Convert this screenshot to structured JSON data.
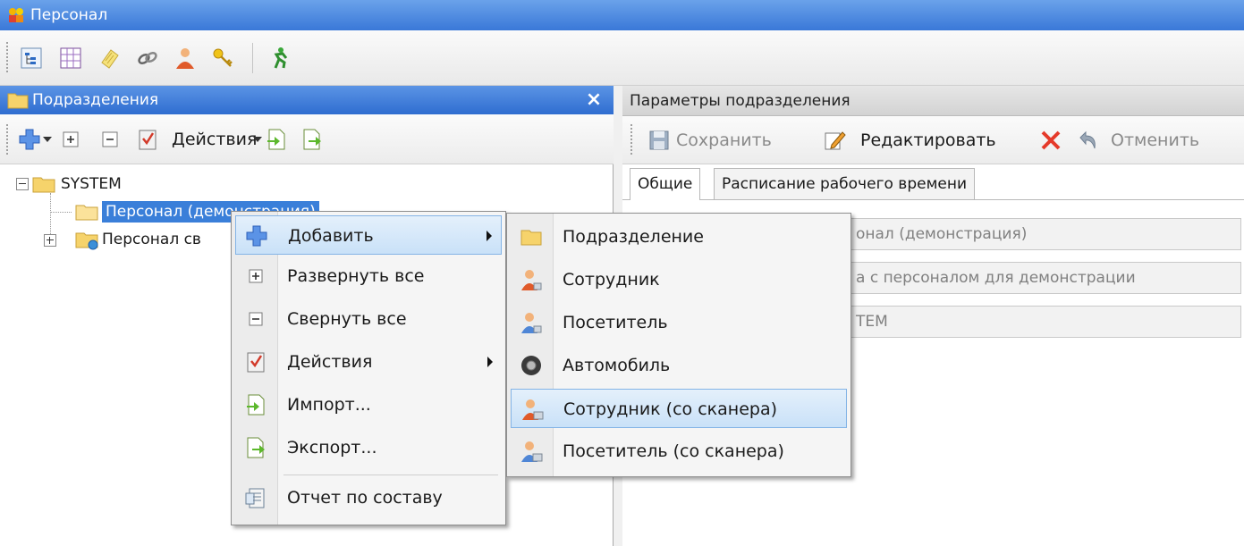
{
  "window": {
    "title": "Персонал"
  },
  "left_panel": {
    "title": "Подразделения",
    "close_symbol": "×",
    "toolbar": {
      "actions_label": "Действия"
    },
    "tree": {
      "root": "SYSTEM",
      "selected_child": "Персонал (демонстрация)",
      "second_child": "Персонал св"
    }
  },
  "right_panel": {
    "title": "Параметры подразделения",
    "toolbar": {
      "save": "Сохранить",
      "edit": "Редактировать",
      "cancel": "Отменить"
    },
    "tabs": [
      "Общие",
      "Расписание рабочего времени"
    ],
    "fields": [
      "онал (демонстрация)",
      "а с персоналом для демонстрации",
      "ТЕМ"
    ]
  },
  "context_menu": {
    "items": [
      {
        "label": "Добавить",
        "icon": "add-cross-icon"
      },
      {
        "label": "Развернуть все",
        "icon": "expand-all-icon"
      },
      {
        "label": "Свернуть все",
        "icon": "collapse-all-icon"
      },
      {
        "label": "Действия",
        "icon": "actions-icon"
      },
      {
        "label": "Импорт...",
        "icon": "import-icon"
      },
      {
        "label": "Экспорт...",
        "icon": "export-icon"
      },
      {
        "label": "Отчет по составу",
        "icon": "report-icon"
      }
    ]
  },
  "submenu": {
    "items": [
      {
        "label": "Подразделение",
        "icon": "folder-icon"
      },
      {
        "label": "Сотрудник",
        "icon": "employee-icon"
      },
      {
        "label": "Посетитель",
        "icon": "visitor-icon"
      },
      {
        "label": "Автомобиль",
        "icon": "car-wheel-icon"
      },
      {
        "label": "Сотрудник (со сканера)",
        "icon": "employee-scanner-icon"
      },
      {
        "label": "Посетитель (со сканера)",
        "icon": "visitor-scanner-icon"
      }
    ]
  },
  "colors": {
    "title_bar": "#3a78d8",
    "highlight": "#c9e1f8",
    "cancel_red": "#e53a2a"
  }
}
